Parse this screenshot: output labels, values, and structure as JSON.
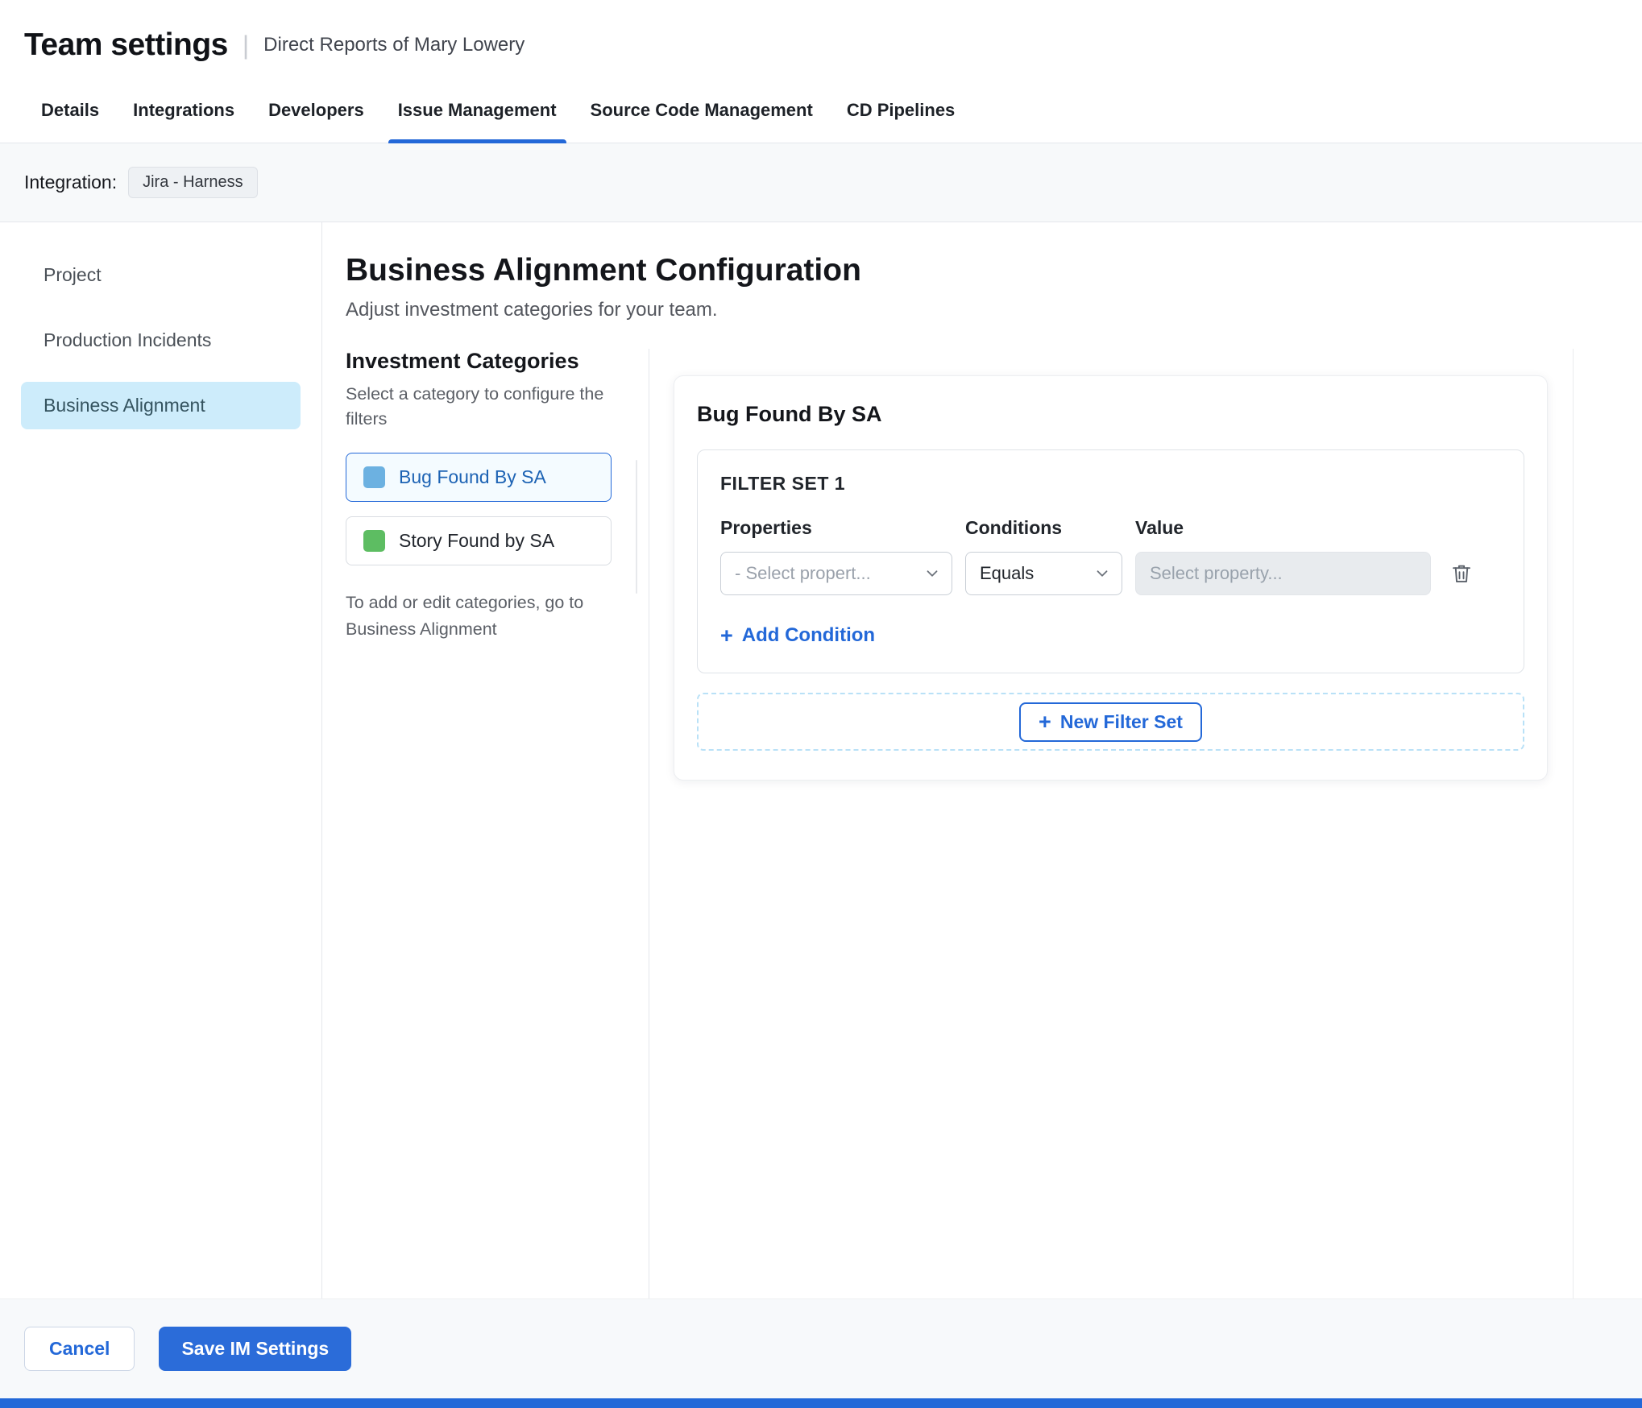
{
  "header": {
    "title": "Team settings",
    "subtitle": "Direct Reports of Mary Lowery"
  },
  "tabs": [
    {
      "label": "Details"
    },
    {
      "label": "Integrations"
    },
    {
      "label": "Developers"
    },
    {
      "label": "Issue Management",
      "active": true
    },
    {
      "label": "Source Code Management"
    },
    {
      "label": "CD Pipelines"
    }
  ],
  "integration": {
    "label": "Integration:",
    "chip": "Jira - Harness"
  },
  "sidebar": {
    "items": [
      {
        "label": "Project"
      },
      {
        "label": "Production Incidents"
      },
      {
        "label": "Business Alignment",
        "active": true
      }
    ]
  },
  "main": {
    "title": "Business Alignment Configuration",
    "subtitle": "Adjust investment categories for your team.",
    "categories": {
      "heading": "Investment Categories",
      "hint": "Select a category to configure the filters",
      "items": [
        {
          "label": "Bug Found By SA",
          "color": "#6cb1e1",
          "selected": true
        },
        {
          "label": "Story Found by SA",
          "color": "#5dbd62",
          "selected": false
        }
      ],
      "footnote": "To add or edit categories, go to Business Alignment"
    },
    "panel": {
      "title": "Bug Found By SA",
      "filter_set": {
        "title": "FILTER SET 1",
        "columns": [
          "Properties",
          "Conditions",
          "Value"
        ],
        "properties_placeholder": "- Select propert...",
        "conditions_value": "Equals",
        "value_placeholder": "Select property...",
        "add_condition_label": "Add Condition"
      },
      "new_filter_set_label": "New Filter Set"
    }
  },
  "footer": {
    "cancel_label": "Cancel",
    "save_label": "Save IM Settings"
  },
  "icons": {
    "plus": "+"
  },
  "colors": {
    "accent": "#2368d8"
  }
}
